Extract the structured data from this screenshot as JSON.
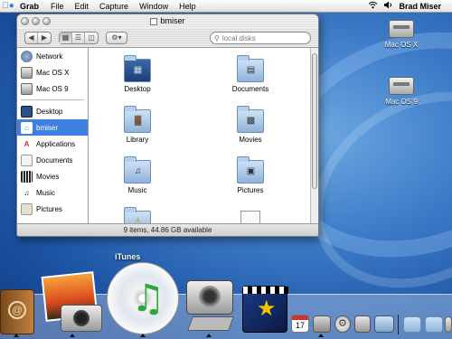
{
  "menubar": {
    "app": "Grab",
    "items": [
      "File",
      "Edit",
      "Capture",
      "Window",
      "Help"
    ],
    "user": "Brad Miser"
  },
  "window": {
    "title": "bmiser",
    "search_placeholder": "local disks",
    "status": "9 items, 44.86 GB available",
    "sidebar": {
      "devices": [
        "Network",
        "Mac OS X",
        "Mac OS 9"
      ],
      "places": [
        "Desktop",
        "bmiser",
        "Applications",
        "Documents",
        "Movies",
        "Music",
        "Pictures"
      ],
      "selected": "bmiser"
    },
    "items": [
      "Desktop",
      "Documents",
      "Library",
      "Movies",
      "Music",
      "Pictures"
    ]
  },
  "desktop": {
    "disks": [
      "Mac OS X",
      "Mac OS 9"
    ]
  },
  "dock": {
    "hover_label": "iTunes",
    "calendar_day": "17"
  }
}
